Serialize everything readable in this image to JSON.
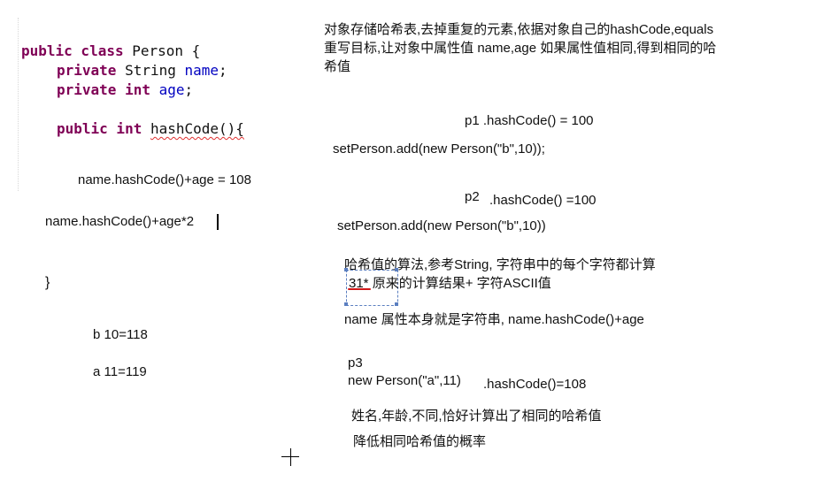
{
  "code": {
    "line1": {
      "kw": "public class",
      "name": "Person {"
    },
    "line2": {
      "kw": "private",
      "type": "String",
      "field": "name",
      "end": ";"
    },
    "line3": {
      "kw": "private int",
      "field": "age",
      "end": ";"
    },
    "line4": {
      "kw": "public int",
      "method": "hashCode",
      "end": "(){"
    },
    "calc1": "name.hashCode()+age = 108",
    "calc2": "name.hashCode()+age*2",
    "close": "}",
    "example_b": "b 10=118",
    "example_a": "a 11=119"
  },
  "notes": {
    "intro_line1": "对象存储哈希表,去掉重复的元素,依据对象自己的hashCode,equals",
    "intro_line2": "重写目标,让对象中属性值 name,age 如果属性值相同,得到相同的哈",
    "intro_line3": "希值",
    "p1_label": "p1 .hashCode() = 100",
    "p1_code": "setPerson.add(new Person(\"b\",10));",
    "p2_label": "p2",
    "p2_hash": ".hashCode() =100",
    "p2_code": "setPerson.add(new Person(\"b\",10))",
    "algo_line1": "哈希值的算法,参考String, 字符串中的每个字符都计算",
    "algo_mult": "31*",
    "algo_line2": " 原来的计算结果+ 字符ASCII值",
    "name_line": "name 属性本身就是字符串, name.hashCode()+age",
    "p3_label": "p3",
    "p3_code": "new Person(\"a\",11)",
    "p3_hash": ".hashCode()=108",
    "conclusion": "姓名,年龄,不同,恰好计算出了相同的哈希值",
    "reduce": "降低相同哈希值的概率"
  }
}
